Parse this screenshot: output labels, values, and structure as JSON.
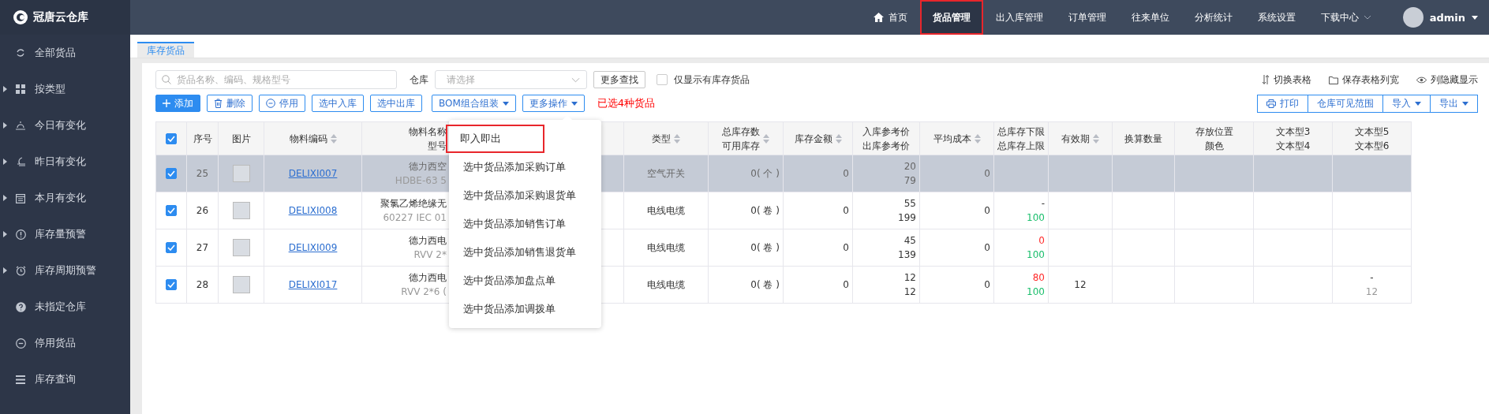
{
  "logo": {
    "text": "冠唐云仓库"
  },
  "top_nav": {
    "items": [
      {
        "label": "首页",
        "kind": "home",
        "selected": false
      },
      {
        "label": "货品管理",
        "kind": "link",
        "selected": true
      },
      {
        "label": "出入库管理",
        "kind": "link",
        "selected": false
      },
      {
        "label": "订单管理",
        "kind": "link",
        "selected": false
      },
      {
        "label": "往来单位",
        "kind": "link",
        "selected": false
      },
      {
        "label": "分析统计",
        "kind": "link",
        "selected": false
      },
      {
        "label": "系统设置",
        "kind": "link",
        "selected": false
      },
      {
        "label": "下载中心",
        "kind": "dropdown",
        "selected": false
      }
    ],
    "user": {
      "name": "admin"
    }
  },
  "sidebar": {
    "items": [
      {
        "label": "全部货品",
        "kind": "leaf"
      },
      {
        "label": "按类型",
        "kind": "group"
      },
      {
        "label": "今日有变化",
        "kind": "group"
      },
      {
        "label": "昨日有变化",
        "kind": "group"
      },
      {
        "label": "本月有变化",
        "kind": "group"
      },
      {
        "label": "库存量预警",
        "kind": "group"
      },
      {
        "label": "库存周期预警",
        "kind": "group"
      },
      {
        "label": "未指定仓库",
        "kind": "leaf"
      },
      {
        "label": "停用货品",
        "kind": "leaf"
      },
      {
        "label": "库存查询",
        "kind": "leaf"
      }
    ]
  },
  "tabs": [
    {
      "label": "库存货品",
      "selected": true
    }
  ],
  "filters": {
    "search": {
      "placeholder": "货品名称、编码、规格型号"
    },
    "warehouse": {
      "label": "仓库",
      "placeholder": "请选择"
    },
    "more_search": "更多查找",
    "only_in_stock": {
      "label": "仅显示有库存货品",
      "checked": false
    }
  },
  "view_links": [
    "切换表格",
    "保存表格列宽",
    "列隐藏显示"
  ],
  "actions": [
    {
      "label": "添加",
      "kind": "primary"
    },
    {
      "label": "删除",
      "kind": "outline"
    },
    {
      "label": "停用",
      "kind": "outline"
    },
    {
      "label": "选中入库",
      "kind": "outline"
    },
    {
      "label": "选中出库",
      "kind": "outline"
    },
    {
      "label": "BOM组合组装",
      "kind": "dropdown"
    },
    {
      "label": "更多操作",
      "kind": "dropdown"
    }
  ],
  "selection_note": "已选4种货品",
  "right_actions": [
    {
      "label": "打印",
      "kind": "print"
    },
    {
      "label": "仓库可见范围",
      "kind": "plain"
    },
    {
      "label": "导入",
      "kind": "dropdown"
    },
    {
      "label": "导出",
      "kind": "dropdown"
    }
  ],
  "more_menu": {
    "items": [
      {
        "label": "即入即出",
        "highlighted": true
      },
      {
        "label": "选中货品添加采购订单",
        "highlighted": false
      },
      {
        "label": "选中货品添加采购退货单",
        "highlighted": false
      },
      {
        "label": "选中货品添加销售订单",
        "highlighted": false
      },
      {
        "label": "选中货品添加销售退货单",
        "highlighted": false
      },
      {
        "label": "选中货品添加盘点单",
        "highlighted": false
      },
      {
        "label": "选中货品添加调拨单",
        "highlighted": false
      }
    ]
  },
  "table": {
    "all_checked": true,
    "columns": [
      {
        "lines": [
          "序号"
        ],
        "sortable": false
      },
      {
        "lines": [
          "图片"
        ],
        "sortable": false
      },
      {
        "lines": [
          "物料编码"
        ],
        "sortable": true
      },
      {
        "lines": [
          "物料名称",
          "型号"
        ],
        "sortable": false
      },
      {
        "lines": [
          "类型"
        ],
        "sortable": true
      },
      {
        "lines": [
          "总库存数",
          "可用库存"
        ],
        "sortable": true
      },
      {
        "lines": [
          "库存金额"
        ],
        "sortable": true
      },
      {
        "lines": [
          "入库参考价",
          "出库参考价"
        ],
        "sortable": false
      },
      {
        "lines": [
          "平均成本"
        ],
        "sortable": true
      },
      {
        "lines": [
          "总库存下限",
          "总库存上限"
        ],
        "sortable": false
      },
      {
        "lines": [
          "有效期"
        ],
        "sortable": true
      },
      {
        "lines": [
          "换算数量"
        ],
        "sortable": false
      },
      {
        "lines": [
          "存放位置",
          "颜色"
        ],
        "sortable": false
      },
      {
        "lines": [
          "文本型3",
          "文本型4"
        ],
        "sortable": false
      },
      {
        "lines": [
          "文本型5",
          "文本型6"
        ],
        "sortable": false
      }
    ],
    "rows": [
      {
        "checked": true,
        "selected": true,
        "no": "25",
        "code": "DELIXI007",
        "name": "德力西空",
        "model": "HDBE-63 5",
        "type": "空气开关",
        "stock": "0( 个 )",
        "amount": "0",
        "prices": [
          "20",
          "79"
        ],
        "avg_cost": "0"
      },
      {
        "checked": true,
        "selected": false,
        "no": "26",
        "code": "DELIXI008",
        "name": "聚氯乙烯绝缘无",
        "model": "60227 IEC 01",
        "type": "电线电缆",
        "stock": "0( 卷 )",
        "amount": "0",
        "prices": [
          "55",
          "199"
        ],
        "avg_cost": "0",
        "limits": [
          {
            "text": "-"
          },
          {
            "text": "100",
            "color": "#19be6b"
          }
        ]
      },
      {
        "checked": true,
        "selected": false,
        "no": "27",
        "code": "DELIXI009",
        "name": "德力西电",
        "model": "RVV 2*",
        "type": "电线电缆",
        "stock": "0( 卷 )",
        "amount": "0",
        "prices": [
          "45",
          "139"
        ],
        "avg_cost": "0",
        "limits": [
          {
            "text": "0",
            "color": "#ff2a2a"
          },
          {
            "text": "100",
            "color": "#19be6b"
          }
        ]
      },
      {
        "checked": true,
        "selected": false,
        "no": "28",
        "code": "DELIXI017",
        "name": "德力西电",
        "model": "RVV 2*6 (",
        "type": "电线电缆",
        "stock": "0( 卷 )",
        "amount": "0",
        "prices": [
          "12",
          "12"
        ],
        "avg_cost": "0",
        "limits": [
          {
            "text": "80",
            "color": "#ff2a2a"
          },
          {
            "text": "100",
            "color": "#19be6b"
          }
        ],
        "expiry": "12",
        "text5": "-",
        "text6": "12"
      }
    ]
  }
}
